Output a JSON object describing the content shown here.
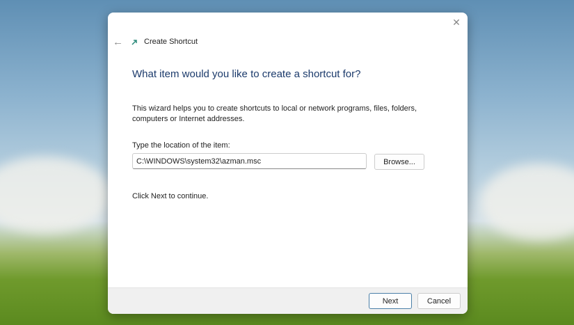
{
  "window": {
    "title": "Create Shortcut"
  },
  "heading": "What item would you like to create a shortcut for?",
  "description": "This wizard helps you to create shortcuts to local or network programs, files, folders, computers or Internet addresses.",
  "location": {
    "label": "Type the location of the item:",
    "value": "C:\\WINDOWS\\system32\\azman.msc",
    "browse_label": "Browse..."
  },
  "continue_text": "Click Next to continue.",
  "buttons": {
    "next": "Next",
    "cancel": "Cancel"
  }
}
